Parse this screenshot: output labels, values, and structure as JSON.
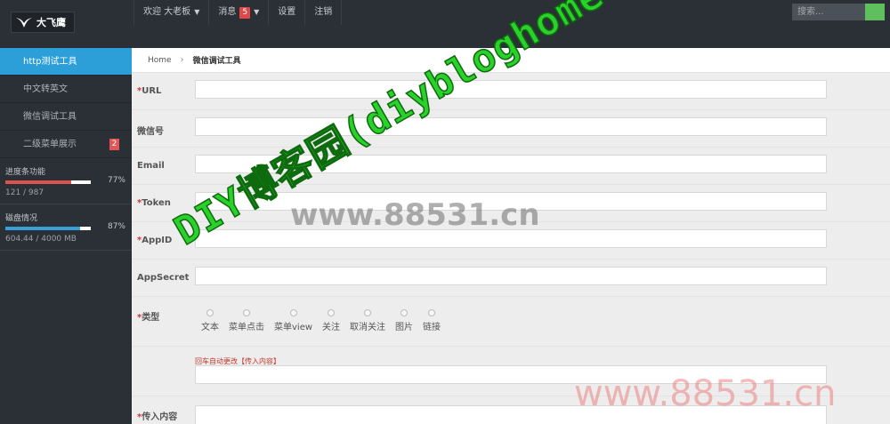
{
  "header": {
    "logo_text": "大飞鹰",
    "nav": [
      {
        "label": "欢迎 大老板",
        "has_caret": true
      },
      {
        "label": "消息",
        "badge": "5",
        "has_caret": true
      },
      {
        "label": "设置"
      },
      {
        "label": "注销"
      }
    ],
    "search_placeholder": "搜索..."
  },
  "sidebar": {
    "items": [
      {
        "label": "http测试工具",
        "active": true
      },
      {
        "label": "中文转英文"
      },
      {
        "label": "微信调试工具"
      },
      {
        "label": "二级菜单展示",
        "badge": "2"
      }
    ],
    "stats": [
      {
        "label": "进度条功能",
        "percent": "77%",
        "fill": 77,
        "detail": "121 / 987",
        "color": "#d9534f"
      },
      {
        "label": "磁盘情况",
        "percent": "87%",
        "fill": 87,
        "detail": "604.44 / 4000 MB",
        "color": "#3a9fd8"
      }
    ]
  },
  "breadcrumb": {
    "home": "Home",
    "current": "微信调试工具"
  },
  "form": {
    "fields": [
      {
        "label": "URL",
        "required": true
      },
      {
        "label": "微信号",
        "required": false
      },
      {
        "label": "Email",
        "required": false
      },
      {
        "label": "Token",
        "required": true
      },
      {
        "label": "AppID",
        "required": true
      },
      {
        "label": "AppSecret",
        "required": false
      }
    ],
    "type_label": "类型",
    "type_options": [
      "文本",
      "菜单点击",
      "菜单view",
      "关注",
      "取消关注",
      "图片",
      "链接"
    ],
    "hint": "回车自动更改【传入内容】",
    "content_label": "传入内容"
  },
  "watermarks": {
    "diagonal": "DIY博客园(diybloghome.com)",
    "center": "www.88531.cn",
    "corner": "www.88531.cn"
  },
  "colors": {
    "active": "#2c9fd8",
    "required": "#d23434",
    "search_button": "#5fbf5f"
  }
}
